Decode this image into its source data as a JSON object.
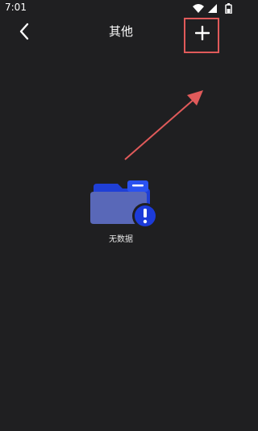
{
  "status_bar": {
    "time": "7:01",
    "icons": [
      "wifi-icon",
      "cellular-signal-icon",
      "battery-icon"
    ]
  },
  "header": {
    "back_icon": "chevron-left-icon",
    "title": "其他",
    "add_icon": "plus-icon"
  },
  "empty_state": {
    "icon": "folder-warning-icon",
    "text": "无数据"
  },
  "colors": {
    "background": "#1f1f21",
    "highlight": "#e05a5a",
    "folder_back": "#1f3fd6",
    "folder_front": "#5968b8",
    "badge": "#1c3bd9"
  }
}
